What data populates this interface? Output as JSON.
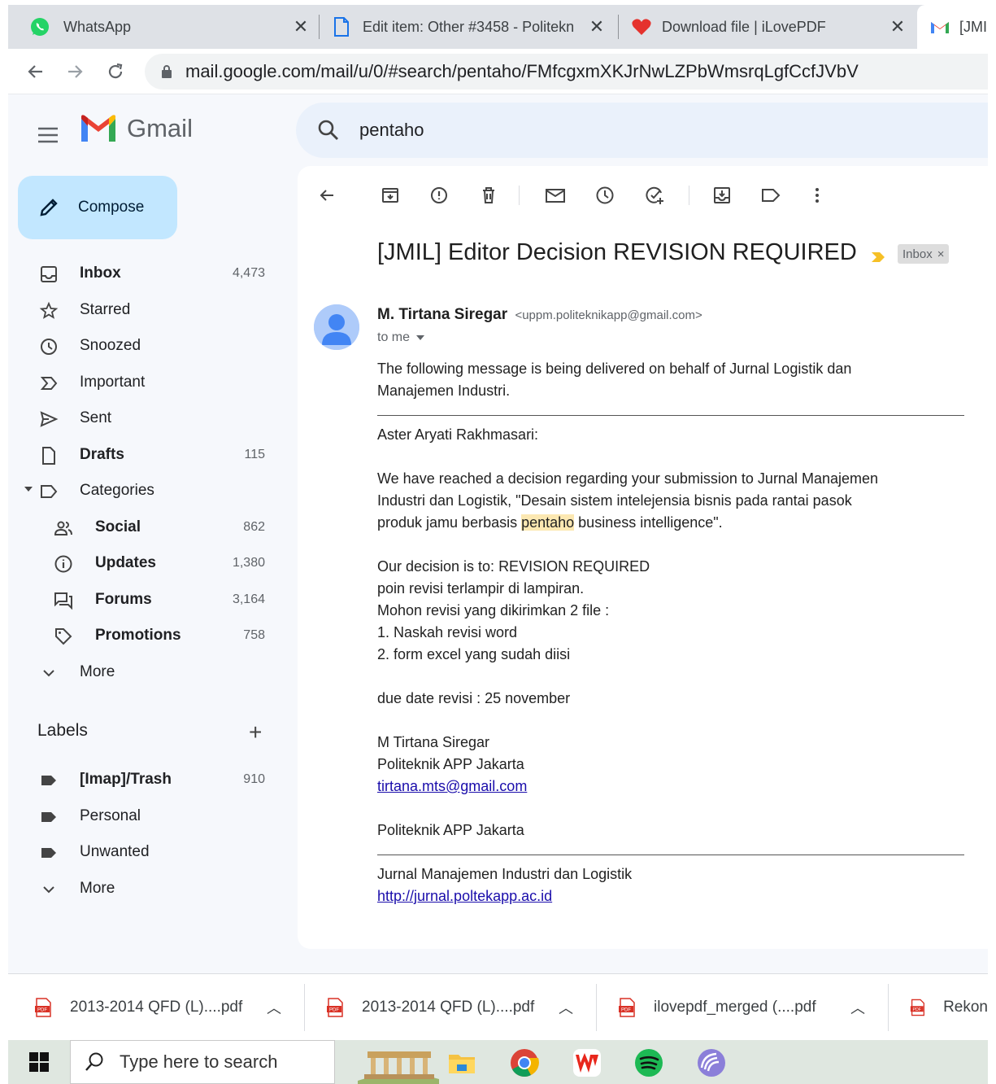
{
  "browser": {
    "tabs": [
      {
        "title": "WhatsApp",
        "icon": "whatsapp-icon"
      },
      {
        "title": "Edit item: Other #3458 - Politekn",
        "icon": "document-icon"
      },
      {
        "title": "Download file | iLovePDF",
        "icon": "ilovepdf-heart-icon"
      },
      {
        "title": "[JMI",
        "icon": "gmail-icon"
      }
    ],
    "url": "mail.google.com/mail/u/0/#search/pentaho/FMfcgxmXKJrNwLZPbWmsrqLgfCcfJVbV"
  },
  "gmail": {
    "brand": "Gmail",
    "search_query": "pentaho",
    "compose_label": "Compose",
    "nav": [
      {
        "label": "Inbox",
        "count": "4,473",
        "icon": "inbox-icon",
        "bold": true
      },
      {
        "label": "Starred",
        "count": "",
        "icon": "star-icon",
        "bold": false
      },
      {
        "label": "Snoozed",
        "count": "",
        "icon": "clock-icon",
        "bold": false
      },
      {
        "label": "Important",
        "count": "",
        "icon": "important-icon",
        "bold": false
      },
      {
        "label": "Sent",
        "count": "",
        "icon": "send-icon",
        "bold": false
      },
      {
        "label": "Drafts",
        "count": "115",
        "icon": "draft-icon",
        "bold": true
      },
      {
        "label": "Categories",
        "count": "",
        "icon": "label-icon",
        "bold": false
      },
      {
        "label": "Social",
        "count": "862",
        "icon": "people-icon",
        "bold": true
      },
      {
        "label": "Updates",
        "count": "1,380",
        "icon": "info-icon",
        "bold": true
      },
      {
        "label": "Forums",
        "count": "3,164",
        "icon": "forum-icon",
        "bold": true
      },
      {
        "label": "Promotions",
        "count": "758",
        "icon": "tag-icon",
        "bold": true
      },
      {
        "label": "More",
        "count": "",
        "icon": "chevron-down-icon",
        "bold": false
      }
    ],
    "labels_heading": "Labels",
    "labels": [
      {
        "label": "[Imap]/Trash",
        "count": "910",
        "bold": true
      },
      {
        "label": "Personal",
        "count": "",
        "bold": false
      },
      {
        "label": "Unwanted",
        "count": "",
        "bold": false
      },
      {
        "label": "More",
        "count": "",
        "bold": false
      }
    ]
  },
  "email": {
    "subject": "[JMIL] Editor Decision REVISION REQUIRED",
    "inbox_chip": "Inbox",
    "inbox_chip_close": "×",
    "sender_name": "M. Tirtana Siregar",
    "sender_email": "<uppm.politeknikapp@gmail.com>",
    "to": "to me",
    "intro_1": "The following message is being delivered on behalf of Jurnal Logistik dan",
    "intro_2": "Manajemen Industri.",
    "greeting": "Aster Aryati Rakhmasari:",
    "para_1": "We have reached a decision regarding your submission to Jurnal Manajemen",
    "para_2": "Industri dan Logistik, \"Desain sistem intelejensia bisnis pada rantai pasok",
    "para_3_pre": "produk jamu berbasis ",
    "para_3_hl": "pentaho",
    "para_3_post": " business intelligence\".",
    "decision": "Our decision is to: REVISION REQUIRED",
    "note_1": "poin revisi terlampir di lampiran.",
    "note_2": "Mohon revisi yang dikirimkan 2 file :",
    "note_3": "1. Naskah revisi word",
    "note_4": "2. form excel yang sudah diisi",
    "due": "due date revisi : 25 november",
    "sig_name": "M Tirtana Siregar",
    "sig_org": "Politeknik APP Jakarta",
    "sig_email": "tirtana.mts@gmail.com",
    "sig_org_2": "Politeknik APP Jakarta",
    "footer_journal": "Jurnal Manajemen Industri dan Logistik",
    "footer_url": "http://jurnal.poltekapp.ac.id"
  },
  "downloads": [
    {
      "name": "2013-2014 QFD (L)....pdf"
    },
    {
      "name": "2013-2014 QFD (L)....pdf"
    },
    {
      "name": "ilovepdf_merged (....pdf"
    },
    {
      "name": "Rekon"
    }
  ],
  "taskbar": {
    "search_placeholder": "Type here to search",
    "apps": [
      "file-explorer-icon",
      "chrome-icon",
      "wps-office-icon",
      "spotify-icon",
      "torrent-icon"
    ]
  },
  "colors": {
    "compose_bg": "#c2e7ff",
    "highlight": "#fce8b2",
    "link": "#1a0dab",
    "important_marker": "#f6c026"
  }
}
